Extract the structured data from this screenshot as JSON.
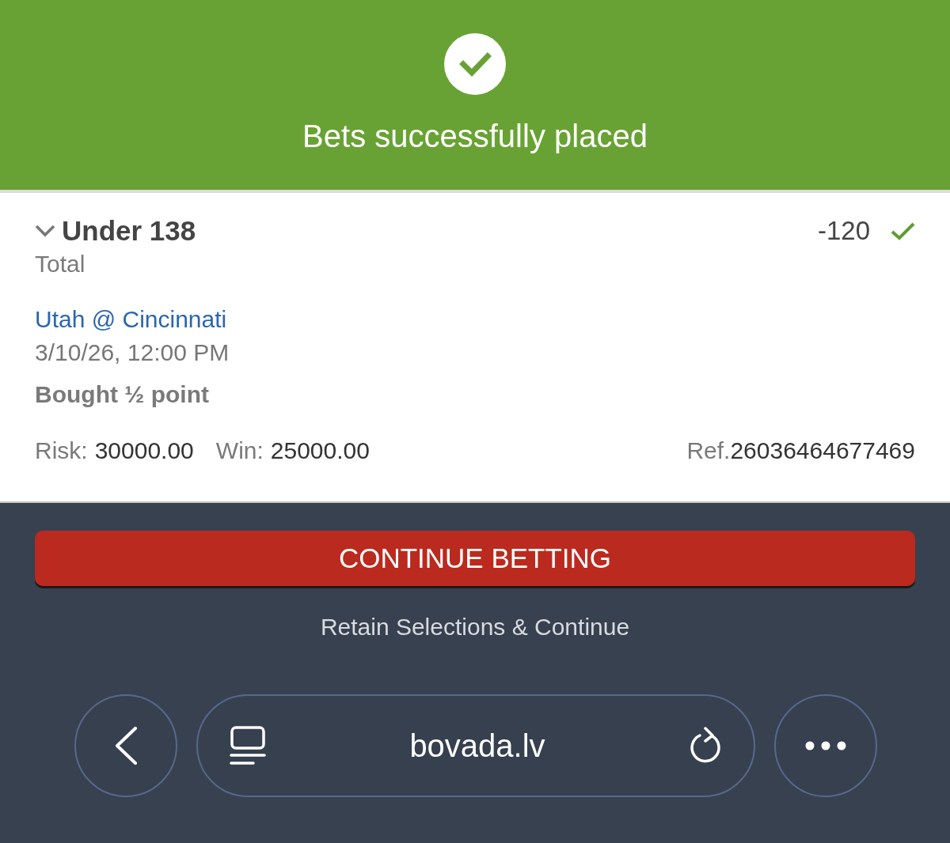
{
  "banner": {
    "message": "Bets successfully placed"
  },
  "bet": {
    "expanded": true,
    "selection": "Under 138",
    "market": "Total",
    "odds": "-120",
    "confirmed": true,
    "event": "Utah @ Cincinnati",
    "start_time": "3/10/26, 12:00 PM",
    "note": "Bought ½ point",
    "risk_label": "Risk:",
    "risk": "30000.00",
    "win_label": "Win:",
    "win": "25000.00",
    "ref_label": "Ref.",
    "ref": "26036464677469"
  },
  "actions": {
    "primary": "CONTINUE BETTING",
    "secondary": "Retain Selections & Continue"
  },
  "browser_bar": {
    "url": "bovada.lv"
  }
}
